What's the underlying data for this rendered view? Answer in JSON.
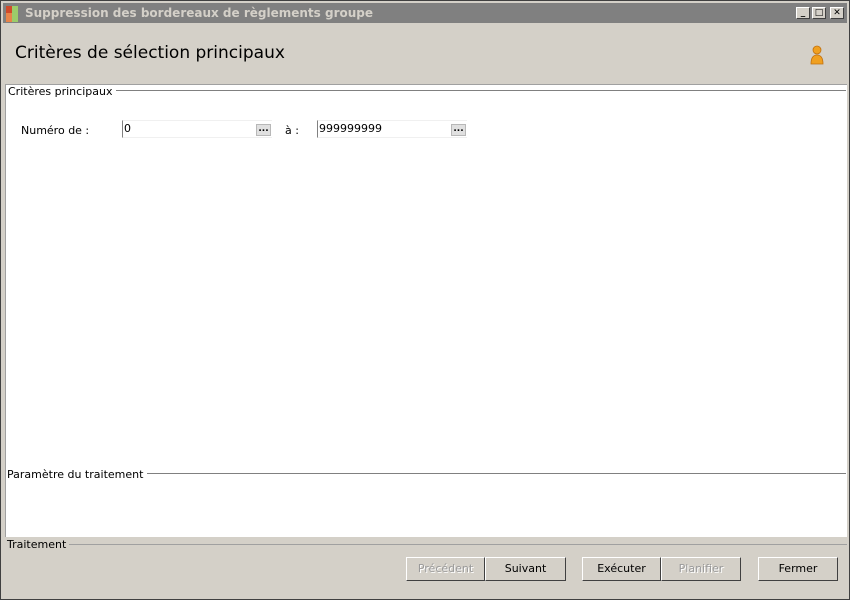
{
  "window": {
    "title": "Suppression des bordereaux de règlements groupe",
    "minimize": "_",
    "maximize": "□",
    "close": "✕"
  },
  "header": {
    "title": "Critères de sélection principaux",
    "icon": "user-icon"
  },
  "criteria_group": {
    "legend": "Critères principaux",
    "from_label": "Numéro de :",
    "from_value": "0",
    "to_label": "à :",
    "to_value": "999999999",
    "ellipsis": "..."
  },
  "params_group": {
    "legend": "Paramètre du traitement"
  },
  "footer": {
    "legend": "Traitement",
    "buttons": {
      "previous": "Précédent",
      "next": "Suivant",
      "execute": "Exécuter",
      "schedule": "Planifier",
      "close": "Fermer"
    }
  },
  "colors": {
    "window_bg": "#d4d0c8",
    "titlebar_bg": "#808080",
    "title_text": "#d4d0c8",
    "panel_bg": "#ffffff",
    "user_icon": "#f0a020"
  }
}
